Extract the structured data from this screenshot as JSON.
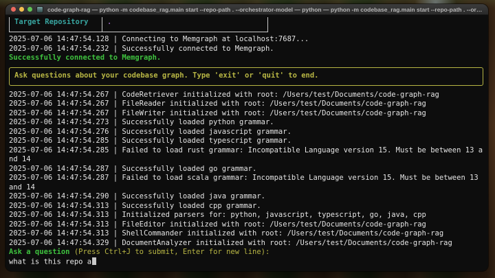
{
  "colors": {
    "accent_green": "#3ec13e",
    "accent_yellow": "#b8b644",
    "accent_cyan": "#38a5a0",
    "accent_magenta": "#8d5fb4",
    "traffic_red": "#ed6a5e",
    "traffic_yellow": "#f4bf4f",
    "traffic_green": "#61c554",
    "terminal_background": "#0d0d0d",
    "terminal_foreground": "#e4e4e4"
  },
  "window": {
    "title": "code-graph-rag — python -m codebase_rag.main start --repo-path . --orchestrator-model — python — python -m codebase_rag.main start --repo-path . --orchestrator-mode...",
    "app_icon": "terminal-app-icon"
  },
  "terminal": {
    "repo_table": {
      "label": "Target Repository",
      "value": "."
    },
    "pre_banner_lines": [
      {
        "text": "2025-07-06 14:47:54.128 | Connecting to Memgraph at localhost:7687...",
        "color": "default"
      },
      {
        "text": "2025-07-06 14:47:54.232 | Successfully connected to Memgraph.",
        "color": "default"
      },
      {
        "text": "Successfully connected to Memgraph.",
        "color": "green"
      }
    ],
    "banner": "Ask questions about your codebase graph. Type 'exit' or 'quit' to end.",
    "post_banner_lines": [
      {
        "text": "2025-07-06 14:47:54.267 | CodeRetriever initialized with root: /Users/test/Documents/code-graph-rag",
        "color": "default"
      },
      {
        "text": "2025-07-06 14:47:54.267 | FileReader initialized with root: /Users/test/Documents/code-graph-rag",
        "color": "default"
      },
      {
        "text": "2025-07-06 14:47:54.267 | FileWriter initialized with root: /Users/test/Documents/code-graph-rag",
        "color": "default"
      },
      {
        "text": "2025-07-06 14:47:54.273 | Successfully loaded python grammar.",
        "color": "default"
      },
      {
        "text": "2025-07-06 14:47:54.276 | Successfully loaded javascript grammar.",
        "color": "default"
      },
      {
        "text": "2025-07-06 14:47:54.285 | Successfully loaded typescript grammar.",
        "color": "default"
      },
      {
        "text": "2025-07-06 14:47:54.285 | Failed to load rust grammar: Incompatible Language version 15. Must be between 13 a",
        "color": "default"
      },
      {
        "text": "nd 14",
        "color": "default"
      },
      {
        "text": "2025-07-06 14:47:54.287 | Successfully loaded go grammar.",
        "color": "default"
      },
      {
        "text": "2025-07-06 14:47:54.287 | Failed to load scala grammar: Incompatible Language version 15. Must be between 13",
        "color": "default"
      },
      {
        "text": "and 14",
        "color": "default"
      },
      {
        "text": "2025-07-06 14:47:54.290 | Successfully loaded java grammar.",
        "color": "default"
      },
      {
        "text": "2025-07-06 14:47:54.313 | Successfully loaded cpp grammar.",
        "color": "default"
      },
      {
        "text": "2025-07-06 14:47:54.313 | Initialized parsers for: python, javascript, typescript, go, java, cpp",
        "color": "default"
      },
      {
        "text": "2025-07-06 14:47:54.313 | FileEditor initialized with root: /Users/test/Documents/code-graph-rag",
        "color": "default"
      },
      {
        "text": "2025-07-06 14:47:54.313 | ShellCommander initialized with root: /Users/test/Documents/code-graph-rag",
        "color": "default"
      },
      {
        "text": "2025-07-06 14:47:54.329 | DocumentAnalyzer initialized with root: /Users/test/Documents/code-graph-rag",
        "color": "default"
      }
    ],
    "prompt": {
      "label": "Ask a question",
      "hint": " (Press Ctrl+J to submit, Enter for new line):",
      "input_value": "what is this repo a"
    }
  }
}
